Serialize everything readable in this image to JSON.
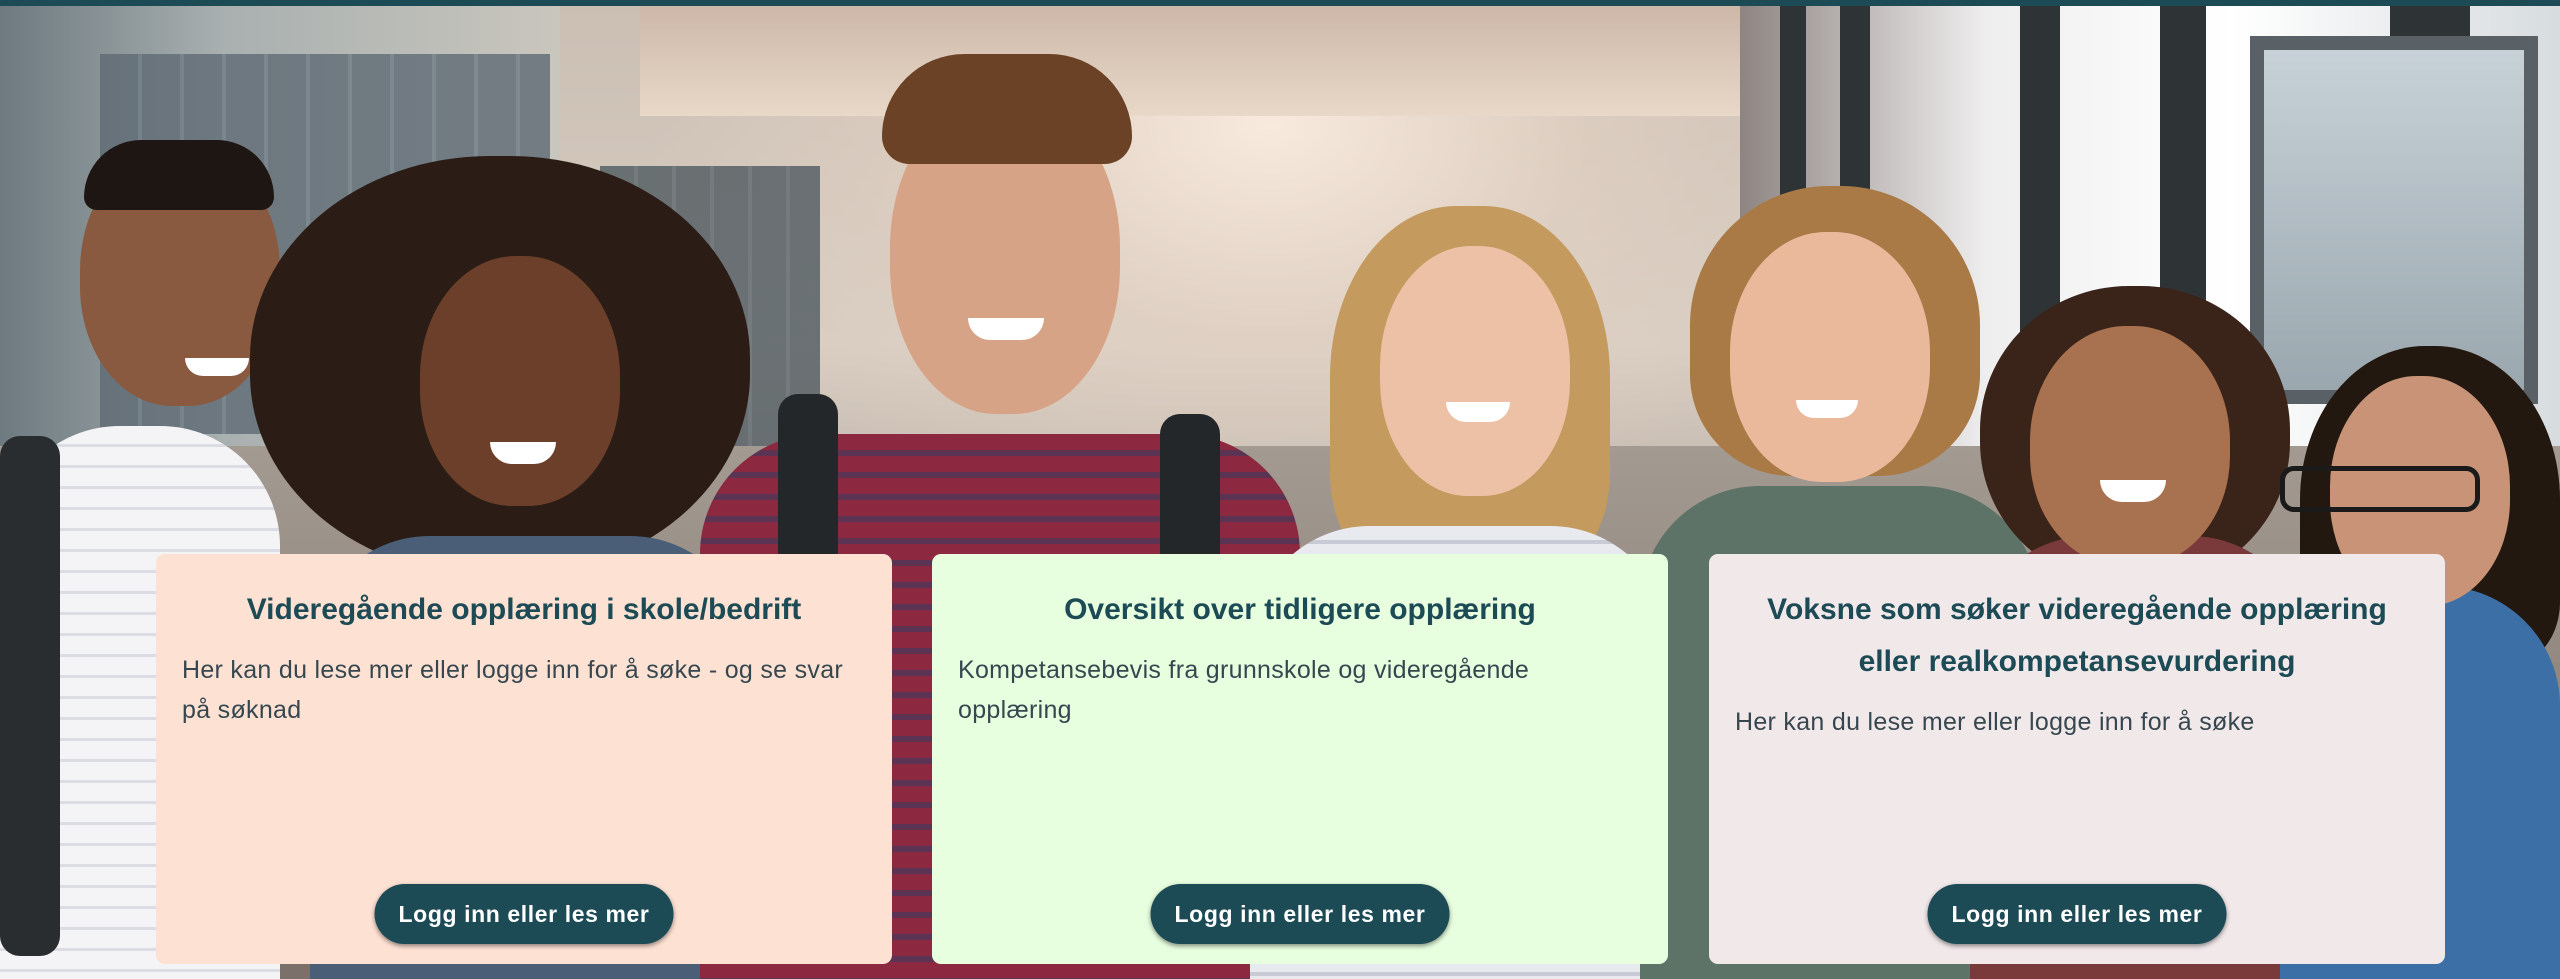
{
  "hero": {
    "image_alt": "Group of smiling teenage students in a school corridor"
  },
  "cards": [
    {
      "title": "Videregående opplæring i skole/bedrift",
      "text": "Her kan du lese mer eller logge inn for å søke - og se svar på søknad",
      "button_label": "Logg inn eller les mer",
      "background": "#fde1d3"
    },
    {
      "title": "Oversikt over tidligere opplæring",
      "text": "Kompetansebevis fra grunnskole og videregående opplæring",
      "button_label": "Logg inn eller les mer",
      "background": "#e7fedf"
    },
    {
      "title": "Voksne som søker videregående opplæring eller realkompetansevurdering",
      "text": "Her kan du lese mer eller logge inn for å søke",
      "button_label": "Logg inn eller les mer",
      "background": "#f1e8ea"
    }
  ],
  "colors": {
    "accent": "#1c4a55",
    "body_text": "#37474f"
  }
}
